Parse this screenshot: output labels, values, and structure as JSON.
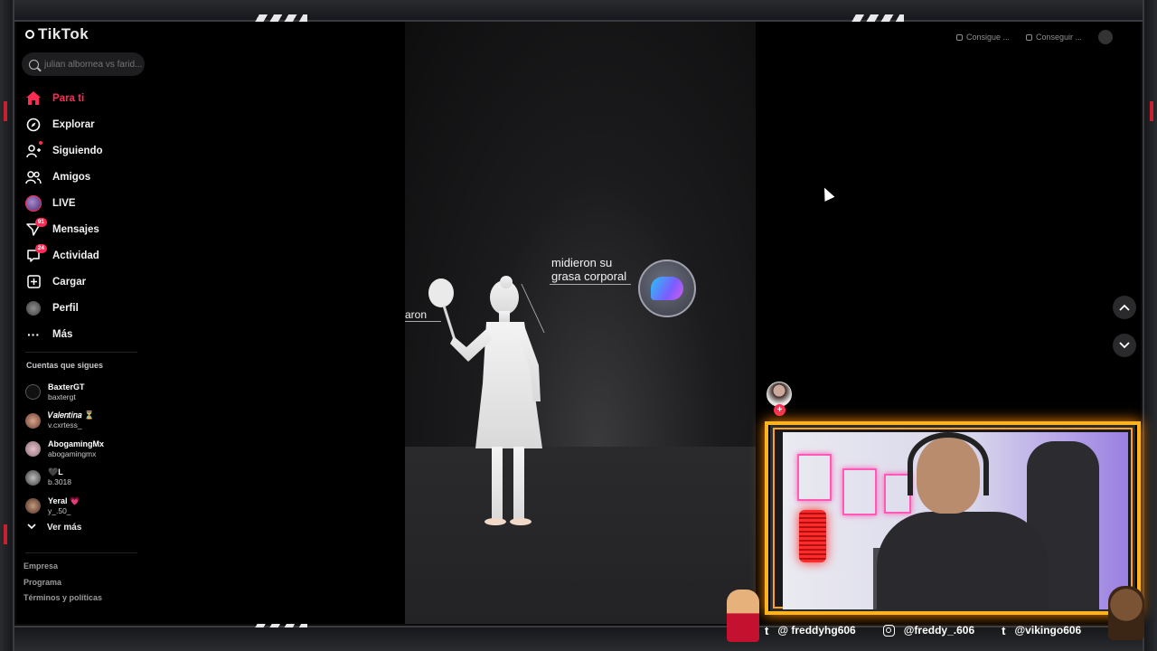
{
  "app": {
    "logo": "TikTok",
    "search_placeholder": "julian albornea vs farid..."
  },
  "nav": [
    {
      "label": "Para ti",
      "icon": "home-icon",
      "active": true
    },
    {
      "label": "Explorar",
      "icon": "compass-icon"
    },
    {
      "label": "Siguiendo",
      "icon": "following-icon"
    },
    {
      "label": "Amigos",
      "icon": "friends-icon"
    },
    {
      "label": "LIVE",
      "icon": "live-avatar-icon"
    },
    {
      "label": "Mensajes",
      "icon": "send-icon",
      "badge": "91"
    },
    {
      "label": "Actividad",
      "icon": "inbox-icon",
      "badge": "24"
    },
    {
      "label": "Cargar",
      "icon": "upload-icon"
    },
    {
      "label": "Perfil",
      "icon": "profile-avatar-icon"
    },
    {
      "label": "Más",
      "icon": "more-icon"
    }
  ],
  "following": {
    "title": "Cuentas que sigues",
    "accounts": [
      {
        "name": "BaxterGT",
        "user": "baxtergt"
      },
      {
        "name": "𝑉𝑎𝑙𝑒𝑛𝑡𝑖𝑛𝑎 ⏳",
        "user": "v.cxrtess_"
      },
      {
        "name": "AbogamingMx",
        "user": "abogamingmx"
      },
      {
        "name": "🖤L",
        "user": "b.3018"
      },
      {
        "name": "Yeral 💗",
        "user": "y_.50_"
      }
    ],
    "see_more": "Ver más"
  },
  "footer": [
    "Empresa",
    "Programa",
    "Términos y políticas"
  ],
  "video": {
    "caption_line1": "midieron su",
    "caption_line2": "grasa corporal",
    "left_word": "aron"
  },
  "topbar": {
    "item1": "Consigue ...",
    "item2": "Conseguir ..."
  },
  "socials": [
    {
      "icon": "tumblr-icon",
      "handle": "@ freddyhg606"
    },
    {
      "icon": "instagram-icon",
      "handle": "@freddy_.606"
    },
    {
      "icon": "tumblr-icon",
      "handle": "@vikingo606"
    }
  ],
  "colors": {
    "accent": "#fe2c55",
    "frame_glow": "#ffb21f"
  }
}
